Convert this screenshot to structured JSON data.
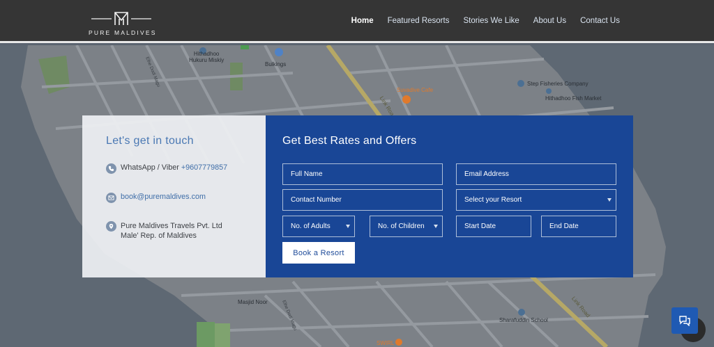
{
  "brand": {
    "name": "PURE MALDIVES"
  },
  "nav": {
    "items": [
      {
        "label": "Home",
        "active": true
      },
      {
        "label": "Featured Resorts"
      },
      {
        "label": "Stories We Like"
      },
      {
        "label": "About Us"
      },
      {
        "label": "Contact Us"
      }
    ]
  },
  "map": {
    "labels": {
      "hithadhoo_mosque": "Hithadhoo\nHukuru Miskiy",
      "bulkings": "Bulkings",
      "suvadive_cafe": "Suvadive Cafe",
      "step_fisheries": "Step Fisheries Company",
      "hithadhoo_fish_market": "Hithadhoo Fish Market",
      "link_road_top": "Link Road",
      "link_road_bottom": "Link Road",
      "masjid_noor": "Masjid Noor",
      "sharafuddin_school": "Sharafuddin School",
      "swirl": "SWIRL",
      "elhe_dodi_magu": "Elhe Dodi Magu",
      "elhe_dodi_magu_2": "Elhe Dodi Magu"
    }
  },
  "contact": {
    "title": "Let's get in touch",
    "whatsapp_label": "WhatsApp / Viber ",
    "whatsapp_number": "+9607779857",
    "email": "book@puremaldives.com",
    "address_line1": "Pure Maldives Travels Pvt. Ltd",
    "address_line2": "Male' Rep. of Maldives"
  },
  "rates": {
    "title": "Get Best Rates and Offers",
    "full_name": "Full Name",
    "email": "Email Address",
    "contact_number": "Contact Number",
    "resort": "Select your Resort",
    "adults": "No. of Adults",
    "children": "No. of Children",
    "start_date": "Start Date",
    "end_date": "End Date",
    "book_button": "Book a Resort"
  },
  "colors": {
    "header_bg": "#353535",
    "form_bg": "#194696",
    "accent": "#4a78b3"
  }
}
